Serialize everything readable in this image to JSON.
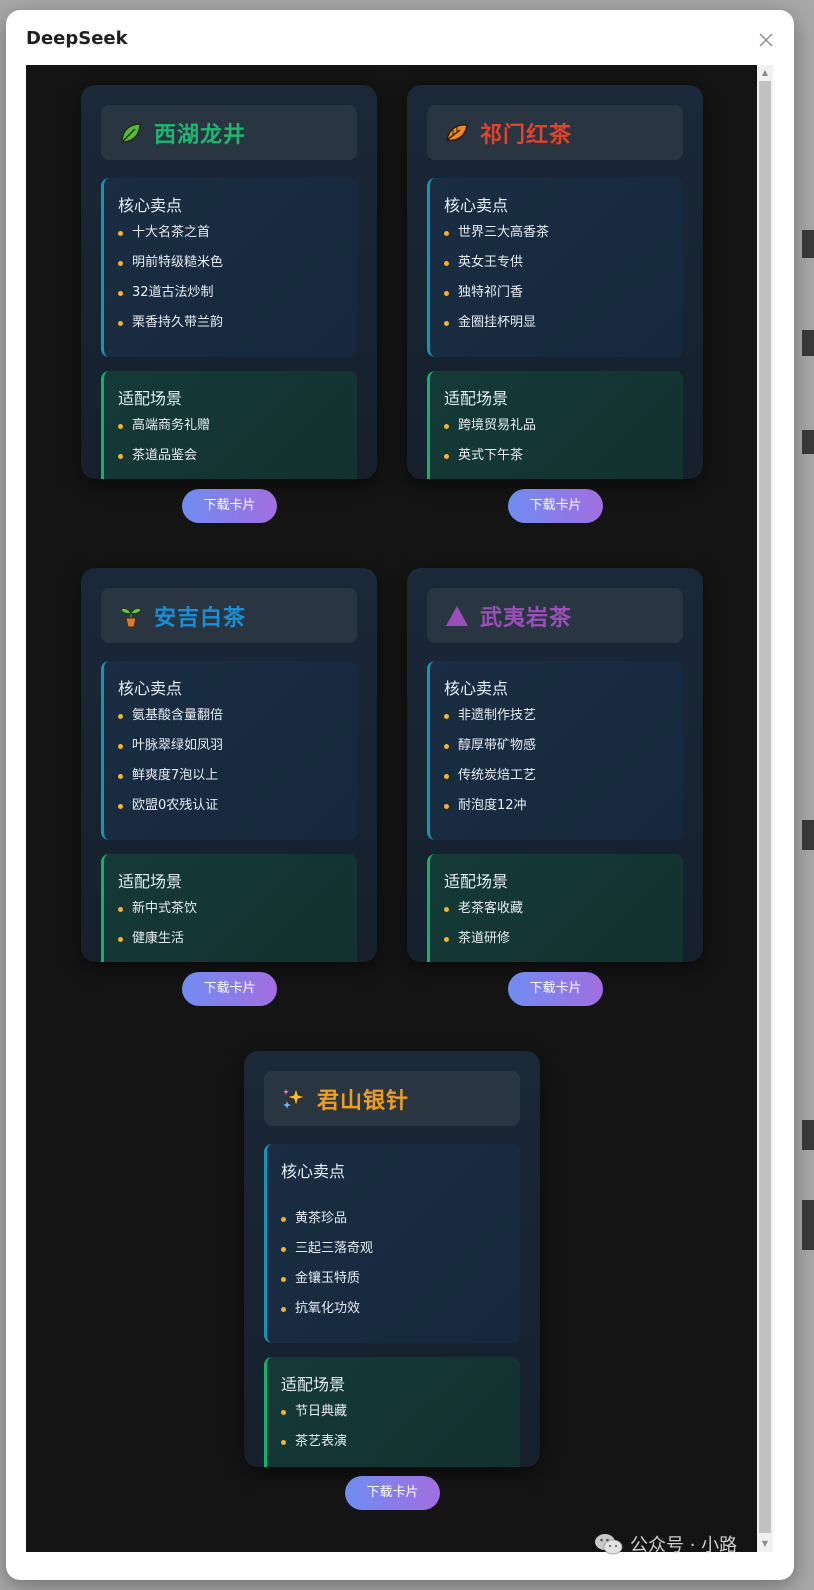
{
  "dialog": {
    "title": "DeepSeek",
    "close_icon": "close-icon"
  },
  "cards": [
    {
      "name": "西湖龙井",
      "icon": "leaf-icon",
      "title_color": "#1db870",
      "core_title": "核心卖点",
      "core_items": [
        "十大名茶之首",
        "明前特级糙米色",
        "32道古法炒制",
        "栗香持久带兰韵"
      ],
      "scene_title": "适配场景",
      "scene_items": [
        "高端商务礼赠",
        "茶道品鉴会"
      ],
      "button": "下载卡片"
    },
    {
      "name": "祁门红茶",
      "icon": "fallen-leaf-icon",
      "title_color": "#e0442c",
      "core_title": "核心卖点",
      "core_items": [
        "世界三大高香茶",
        "英女王专供",
        "独特祁门香",
        "金圈挂杯明显"
      ],
      "scene_title": "适配场景",
      "scene_items": [
        "跨境贸易礼品",
        "英式下午茶"
      ],
      "button": "下载卡片"
    },
    {
      "name": "安吉白茶",
      "icon": "seedling-icon",
      "title_color": "#1a8fd6",
      "core_title": "核心卖点",
      "core_items": [
        "氨基酸含量翻倍",
        "叶脉翠绿如凤羽",
        "鲜爽度7泡以上",
        "欧盟0农残认证"
      ],
      "scene_title": "适配场景",
      "scene_items": [
        "新中式茶饮",
        "健康生活"
      ],
      "button": "下载卡片"
    },
    {
      "name": "武夷岩茶",
      "icon": "triangle-icon",
      "title_color": "#9b4fb8",
      "core_title": "核心卖点",
      "core_items": [
        "非遗制作技艺",
        "醇厚带矿物感",
        "传统炭焙工艺",
        "耐泡度12冲"
      ],
      "scene_title": "适配场景",
      "scene_items": [
        "老茶客收藏",
        "茶道研修"
      ],
      "button": "下载卡片"
    },
    {
      "name": "君山银针",
      "icon": "sparkles-icon",
      "title_color": "#ef9d1c",
      "core_title": "核心卖点",
      "core_items": [
        "黄茶珍品",
        "三起三落奇观",
        "金镶玉特质",
        "抗氧化功效"
      ],
      "scene_title": "适配场景",
      "scene_items": [
        "节日典藏",
        "茶艺表演"
      ],
      "button": "下载卡片"
    }
  ],
  "watermark": {
    "text": "公众号 · 小路",
    "icon": "wechat-icon"
  }
}
